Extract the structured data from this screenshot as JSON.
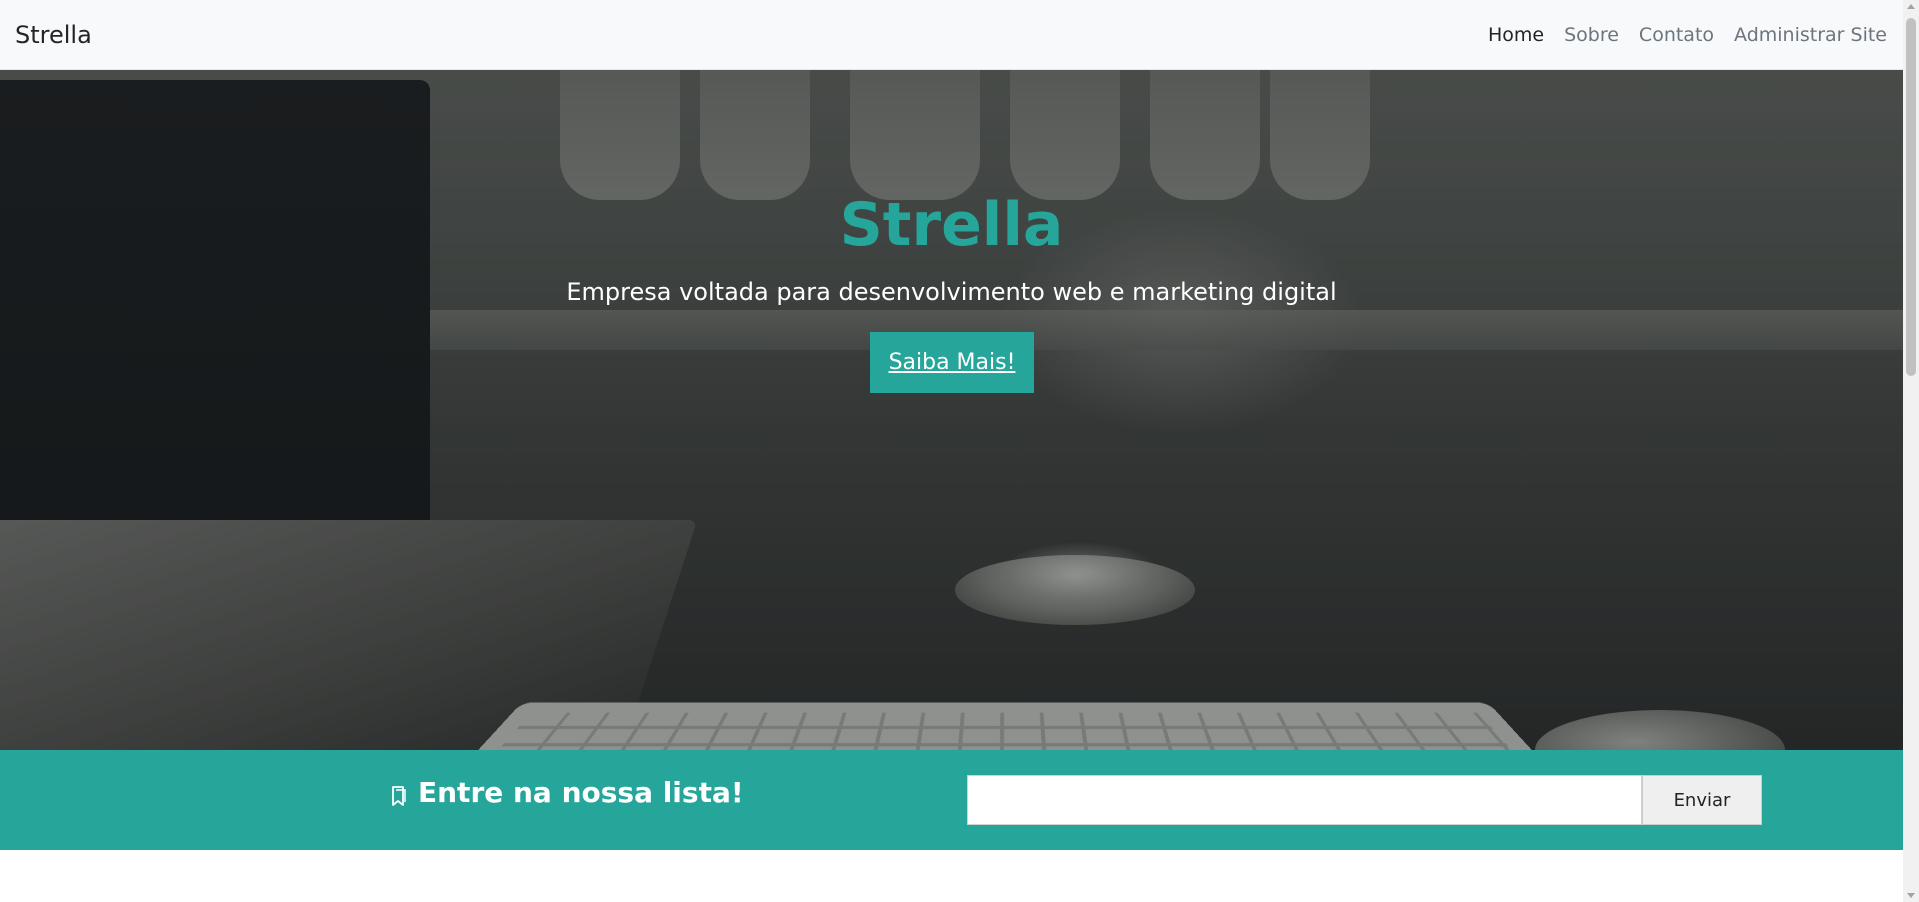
{
  "navbar": {
    "brand": "Strella",
    "links": [
      {
        "label": "Home",
        "active": true
      },
      {
        "label": "Sobre",
        "active": false
      },
      {
        "label": "Contato",
        "active": false
      },
      {
        "label": "Administrar Site",
        "active": false
      }
    ]
  },
  "hero": {
    "title": "Strella",
    "subtitle": "Empresa voltada para desenvolvimento web e marketing digital",
    "cta_label": "Saiba Mais!"
  },
  "newsletter": {
    "icon": "bookmark-icon",
    "title": "Entre na nossa lista!",
    "email_value": "",
    "submit_label": "Enviar"
  },
  "colors": {
    "accent": "#26a69a",
    "navbar_bg": "#f8f9fa",
    "text_dark": "#212529",
    "text_muted": "#6c757d"
  }
}
